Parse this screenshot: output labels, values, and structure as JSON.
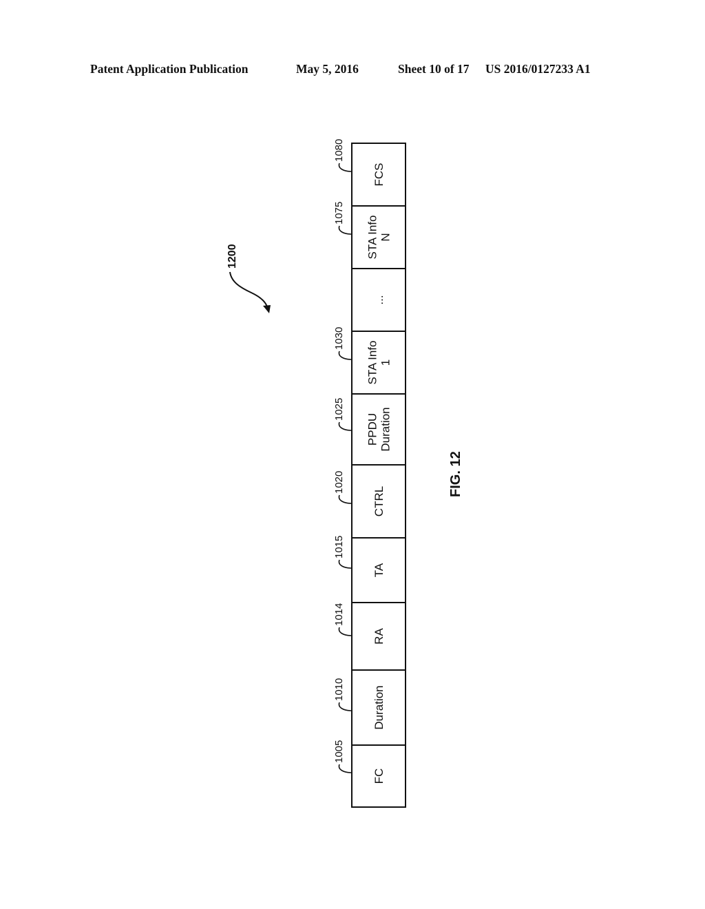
{
  "header": {
    "publication": "Patent Application Publication",
    "date": "May 5, 2016",
    "sheet": "Sheet 10 of 17",
    "number": "US 2016/0127233 A1"
  },
  "figure": {
    "label": "FIG. 12",
    "reference": "1200",
    "fields": [
      {
        "lines": [
          "FC"
        ],
        "ref": "1005"
      },
      {
        "lines": [
          "Duration"
        ],
        "ref": "1010"
      },
      {
        "lines": [
          "RA"
        ],
        "ref": "1014"
      },
      {
        "lines": [
          "TA"
        ],
        "ref": "1015"
      },
      {
        "lines": [
          "CTRL"
        ],
        "ref": "1020"
      },
      {
        "lines": [
          "PPDU",
          "Duration"
        ],
        "ref": "1025"
      },
      {
        "lines": [
          "STA Info",
          "1"
        ],
        "ref": "1030"
      },
      {
        "lines": [
          "..."
        ],
        "ref": ""
      },
      {
        "lines": [
          "STA Info",
          "N"
        ],
        "ref": "1075"
      },
      {
        "lines": [
          "FCS"
        ],
        "ref": "1080"
      }
    ]
  }
}
